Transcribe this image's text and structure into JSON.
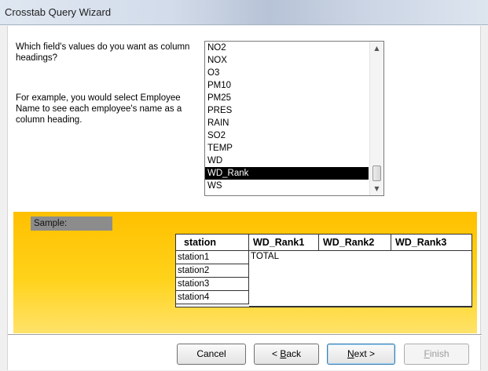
{
  "window": {
    "title": "Crosstab Query Wizard"
  },
  "prompt": {
    "question": "Which field's values do you want as column headings?",
    "example": "For example, you would select Employee Name to see each employee's name as a column heading."
  },
  "fields": {
    "items": [
      "NO2",
      "NOX",
      "O3",
      "PM10",
      "PM25",
      "PRES",
      "RAIN",
      "SO2",
      "TEMP",
      "WD",
      "WD_Rank",
      "WS"
    ],
    "selected": "WD_Rank"
  },
  "sample": {
    "label": "Sample:",
    "row_header": "station",
    "columns": [
      "WD_Rank1",
      "WD_Rank2",
      "WD_Rank3"
    ],
    "rows": [
      "station1",
      "station2",
      "station3",
      "station4"
    ],
    "total_label": "TOTAL"
  },
  "buttons": {
    "cancel": "Cancel",
    "back_prefix": "< ",
    "back_mnemonic": "B",
    "back_rest": "ack",
    "next_mnemonic": "N",
    "next_rest": "ext >",
    "finish_mnemonic": "F",
    "finish_rest": "inish"
  },
  "colors": {
    "sample_panel": "#ffc000",
    "selection": "#000000",
    "sample_label_bg": "#8c8c8c"
  },
  "icons": {
    "scroll_up": "scroll-up-arrow-icon",
    "scroll_down": "scroll-down-arrow-icon"
  }
}
